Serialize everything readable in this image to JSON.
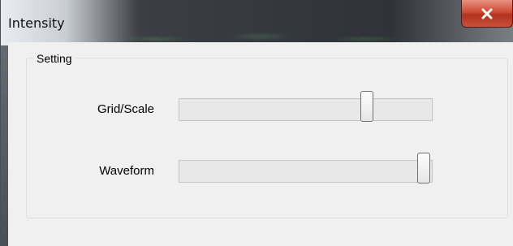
{
  "window": {
    "title": "Intensity",
    "close_icon": "close-icon"
  },
  "group": {
    "label": "Setting"
  },
  "sliders": [
    {
      "label": "Grid/Scale",
      "value": 0.76
    },
    {
      "label": "Waveform",
      "value": 1.0
    }
  ],
  "colors": {
    "client_bg": "#f0f0f0",
    "close_button": "#c9513a"
  }
}
